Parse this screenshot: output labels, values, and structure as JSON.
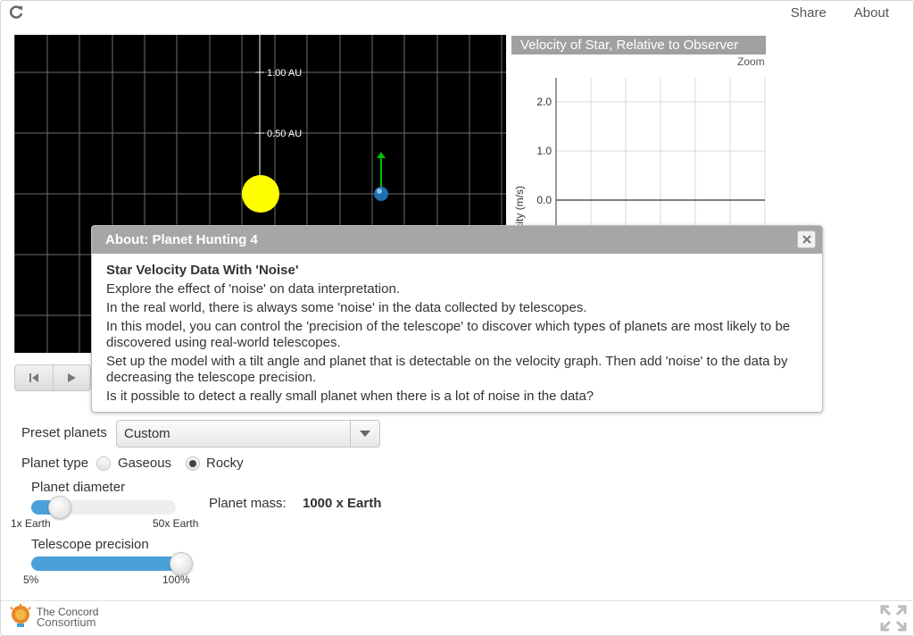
{
  "topbar": {
    "share_label": "Share",
    "about_label": "About"
  },
  "space_view": {
    "au_labels": [
      "1.00 AU",
      "0.50 AU"
    ],
    "star_color": "#ffff00",
    "planet_color": "#1f6fb2",
    "velocity_arrow_color": "#00c000"
  },
  "graph": {
    "title": "Velocity of Star, Relative to Observer",
    "zoom_label": "Zoom",
    "ylabel": "Velocity (m/s)",
    "y_ticks": [
      "2.0",
      "1.0",
      "0.0"
    ]
  },
  "chart_data": {
    "type": "line",
    "title": "Velocity of Star, Relative to Observer",
    "ylabel": "Velocity (m/s)",
    "y_ticks": [
      2.0,
      1.0,
      0.0
    ],
    "series": [
      {
        "values": [
          0.0,
          0.0
        ]
      }
    ],
    "grid": true
  },
  "dialog": {
    "title": "About: Planet Hunting 4",
    "heading": "Star Velocity Data With 'Noise'",
    "paragraphs": [
      "Explore the effect of 'noise' on data interpretation.",
      "In the real world, there is always some 'noise' in the data collected by telescopes.",
      "In this model, you can control the 'precision of the telescope' to discover which types of planets are most likely to be discovered using real-world telescopes.",
      "Set up the model with a tilt angle and planet that is detectable on the velocity graph. Then add 'noise' to the data by decreasing the telescope precision.",
      "Is it possible to detect a really small planet when there is a lot of noise in the data?"
    ]
  },
  "controls": {
    "preset_label": "Preset planets",
    "preset_value": "Custom",
    "planet_type_label": "Planet type",
    "planet_type_options": [
      "Gaseous",
      "Rocky"
    ],
    "planet_type_selected": "Rocky",
    "diameter_label": "Planet diameter",
    "diameter_min": "1x Earth",
    "diameter_max": "50x Earth",
    "diameter_fraction": 0.2,
    "mass_label": "Planet mass:",
    "mass_value": "1000 x Earth",
    "precision_label": "Telescope precision",
    "precision_min": "5%",
    "precision_max": "100%",
    "precision_fraction": 1.0
  },
  "footer": {
    "logo_line1": "The Concord",
    "logo_line2": "Consortium"
  }
}
